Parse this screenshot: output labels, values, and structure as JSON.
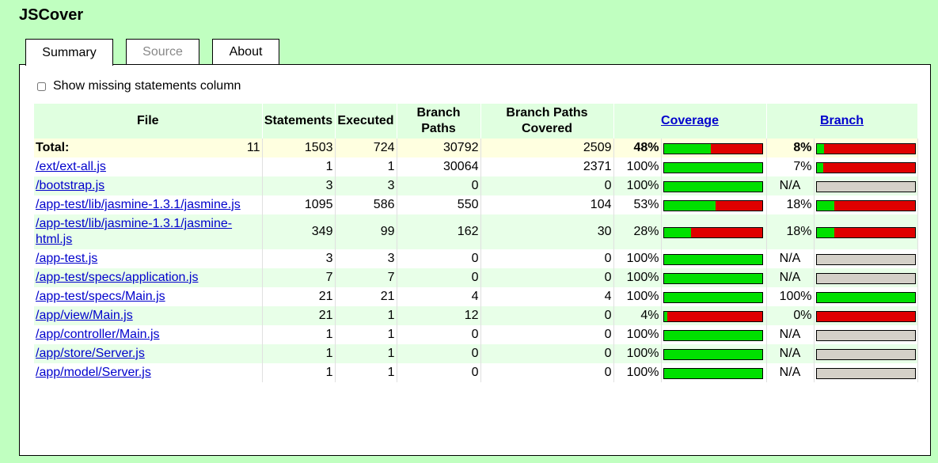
{
  "app": {
    "title": "JSCover"
  },
  "tabs": [
    {
      "label": "Summary",
      "state": "active"
    },
    {
      "label": "Source",
      "state": "disabled"
    },
    {
      "label": "About",
      "state": "normal"
    }
  ],
  "options": {
    "missing_statements_label": "Show missing statements column",
    "missing_statements_checked": false
  },
  "colors": {
    "covered": "#00e000",
    "uncovered": "#e00000",
    "not_applicable": "#d4d0c8",
    "background": "#c0ffc0",
    "header": "#e0ffe0",
    "total_row": "#ffffe0"
  },
  "table": {
    "headers": {
      "file": "File",
      "statements": "Statements",
      "executed": "Executed",
      "branch_paths": "Branch Paths",
      "branch_paths_covered": "Branch Paths Covered",
      "coverage": "Coverage",
      "branch": "Branch"
    },
    "total": {
      "label": "Total:",
      "count": "11",
      "statements": "1503",
      "executed": "724",
      "branch_paths": "30792",
      "branch_paths_covered": "2509",
      "coverage_pct": "48%",
      "coverage_value": 48,
      "branch_pct": "8%",
      "branch_value": 8
    },
    "rows": [
      {
        "file": "/ext/ext-all.js",
        "statements": "1",
        "executed": "1",
        "branch_paths": "30064",
        "branch_paths_covered": "2371",
        "coverage_pct": "100%",
        "coverage_value": 100,
        "branch_pct": "7%",
        "branch_value": 7
      },
      {
        "file": "/bootstrap.js",
        "statements": "3",
        "executed": "3",
        "branch_paths": "0",
        "branch_paths_covered": "0",
        "coverage_pct": "100%",
        "coverage_value": 100,
        "branch_pct": "N/A",
        "branch_value": null
      },
      {
        "file": "/app-test/lib/jasmine-1.3.1/jasmine.js",
        "statements": "1095",
        "executed": "586",
        "branch_paths": "550",
        "branch_paths_covered": "104",
        "coverage_pct": "53%",
        "coverage_value": 53,
        "branch_pct": "18%",
        "branch_value": 18
      },
      {
        "file": "/app-test/lib/jasmine-1.3.1/jasmine-html.js",
        "statements": "349",
        "executed": "99",
        "branch_paths": "162",
        "branch_paths_covered": "30",
        "coverage_pct": "28%",
        "coverage_value": 28,
        "branch_pct": "18%",
        "branch_value": 18
      },
      {
        "file": "/app-test.js",
        "statements": "3",
        "executed": "3",
        "branch_paths": "0",
        "branch_paths_covered": "0",
        "coverage_pct": "100%",
        "coverage_value": 100,
        "branch_pct": "N/A",
        "branch_value": null
      },
      {
        "file": "/app-test/specs/application.js",
        "statements": "7",
        "executed": "7",
        "branch_paths": "0",
        "branch_paths_covered": "0",
        "coverage_pct": "100%",
        "coverage_value": 100,
        "branch_pct": "N/A",
        "branch_value": null
      },
      {
        "file": "/app-test/specs/Main.js",
        "statements": "21",
        "executed": "21",
        "branch_paths": "4",
        "branch_paths_covered": "4",
        "coverage_pct": "100%",
        "coverage_value": 100,
        "branch_pct": "100%",
        "branch_value": 100
      },
      {
        "file": "/app/view/Main.js",
        "statements": "21",
        "executed": "1",
        "branch_paths": "12",
        "branch_paths_covered": "0",
        "coverage_pct": "4%",
        "coverage_value": 4,
        "branch_pct": "0%",
        "branch_value": 0
      },
      {
        "file": "/app/controller/Main.js",
        "statements": "1",
        "executed": "1",
        "branch_paths": "0",
        "branch_paths_covered": "0",
        "coverage_pct": "100%",
        "coverage_value": 100,
        "branch_pct": "N/A",
        "branch_value": null
      },
      {
        "file": "/app/store/Server.js",
        "statements": "1",
        "executed": "1",
        "branch_paths": "0",
        "branch_paths_covered": "0",
        "coverage_pct": "100%",
        "coverage_value": 100,
        "branch_pct": "N/A",
        "branch_value": null
      },
      {
        "file": "/app/model/Server.js",
        "statements": "1",
        "executed": "1",
        "branch_paths": "0",
        "branch_paths_covered": "0",
        "coverage_pct": "100%",
        "coverage_value": 100,
        "branch_pct": "N/A",
        "branch_value": null
      }
    ]
  }
}
